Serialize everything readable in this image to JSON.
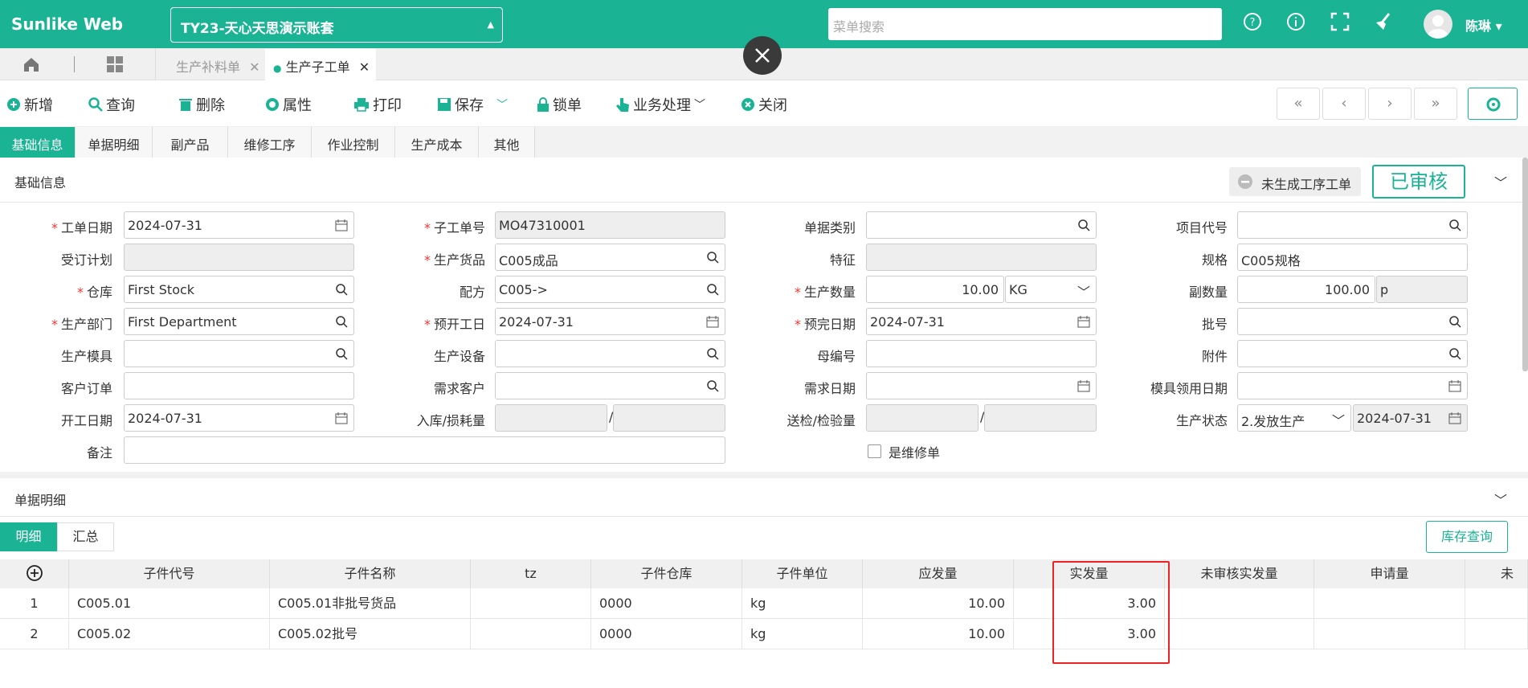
{
  "app": {
    "logo": "Sunlike Web",
    "account": "TY23-天心天思演示账套",
    "search_placeholder": "菜单搜索",
    "user": "陈琳"
  },
  "tabs": [
    {
      "label": "生产补料单"
    },
    {
      "label": "生产子工单"
    }
  ],
  "toolbar": {
    "new": "新增",
    "query": "查询",
    "delete": "删除",
    "props": "属性",
    "print": "打印",
    "save": "保存",
    "lock": "锁单",
    "business": "业务处理",
    "close": "关闭"
  },
  "subtabs": [
    "基础信息",
    "单据明细",
    "副产品",
    "维修工序",
    "作业控制",
    "生产成本",
    "其他"
  ],
  "basic": {
    "title": "基础信息",
    "status_gray": "未生成工序工单",
    "status_ok": "已审核"
  },
  "fields": {
    "order_date": {
      "label": "工单日期",
      "value": "2024-07-31"
    },
    "sub_order_no": {
      "label": "子工单号",
      "value": "MO47310001"
    },
    "doc_type": {
      "label": "单据类别",
      "value": ""
    },
    "project_code": {
      "label": "项目代号",
      "value": ""
    },
    "sub_plan": {
      "label": "受订计划",
      "value": ""
    },
    "product": {
      "label": "生产货品",
      "value": "C005成品"
    },
    "feature": {
      "label": "特征",
      "value": ""
    },
    "spec": {
      "label": "规格",
      "value": "C005规格"
    },
    "warehouse": {
      "label": "仓库",
      "value": "First Stock"
    },
    "formula": {
      "label": "配方",
      "value": "C005->"
    },
    "prod_qty": {
      "label": "生产数量",
      "value": "10.00",
      "unit": "KG"
    },
    "sub_qty": {
      "label": "副数量",
      "value": "100.00",
      "unit": "p"
    },
    "dept": {
      "label": "生产部门",
      "value": "First Department"
    },
    "start_plan": {
      "label": "预开工日",
      "value": "2024-07-31"
    },
    "finish_plan": {
      "label": "预完日期",
      "value": "2024-07-31"
    },
    "batch": {
      "label": "批号",
      "value": ""
    },
    "mold": {
      "label": "生产模具",
      "value": ""
    },
    "equipment": {
      "label": "生产设备",
      "value": ""
    },
    "parent_no": {
      "label": "母编号",
      "value": ""
    },
    "attachment": {
      "label": "附件",
      "value": ""
    },
    "customer_order": {
      "label": "客户订单",
      "value": ""
    },
    "demand_customer": {
      "label": "需求客户",
      "value": ""
    },
    "demand_date": {
      "label": "需求日期",
      "value": ""
    },
    "mold_date": {
      "label": "模具领用日期",
      "value": ""
    },
    "start_date": {
      "label": "开工日期",
      "value": "2024-07-31"
    },
    "in_loss": {
      "label": "入库/损耗量",
      "sep": "/"
    },
    "inspect": {
      "label": "送检/检验量",
      "sep": "/"
    },
    "prod_status": {
      "label": "生产状态",
      "value": "2.发放生产",
      "date": "2024-07-31"
    },
    "remark": {
      "label": "备注",
      "value": ""
    },
    "repair": {
      "label": "是维修单"
    }
  },
  "detail": {
    "title": "单据明细",
    "tab_detail": "明细",
    "tab_summary": "汇总",
    "stock_btn": "库存查询"
  },
  "table": {
    "headers": [
      "子件代号",
      "子件名称",
      "tz",
      "子件仓库",
      "子件单位",
      "应发量",
      "实发量",
      "未审核实发量",
      "申请量",
      "未"
    ],
    "rows": [
      [
        "1",
        "C005.01",
        "C005.01非批号货品",
        "",
        "0000",
        "kg",
        "10.00",
        "3.00"
      ],
      [
        "2",
        "C005.02",
        "C005.02批号",
        "",
        "0000",
        "kg",
        "10.00",
        "3.00"
      ]
    ]
  }
}
